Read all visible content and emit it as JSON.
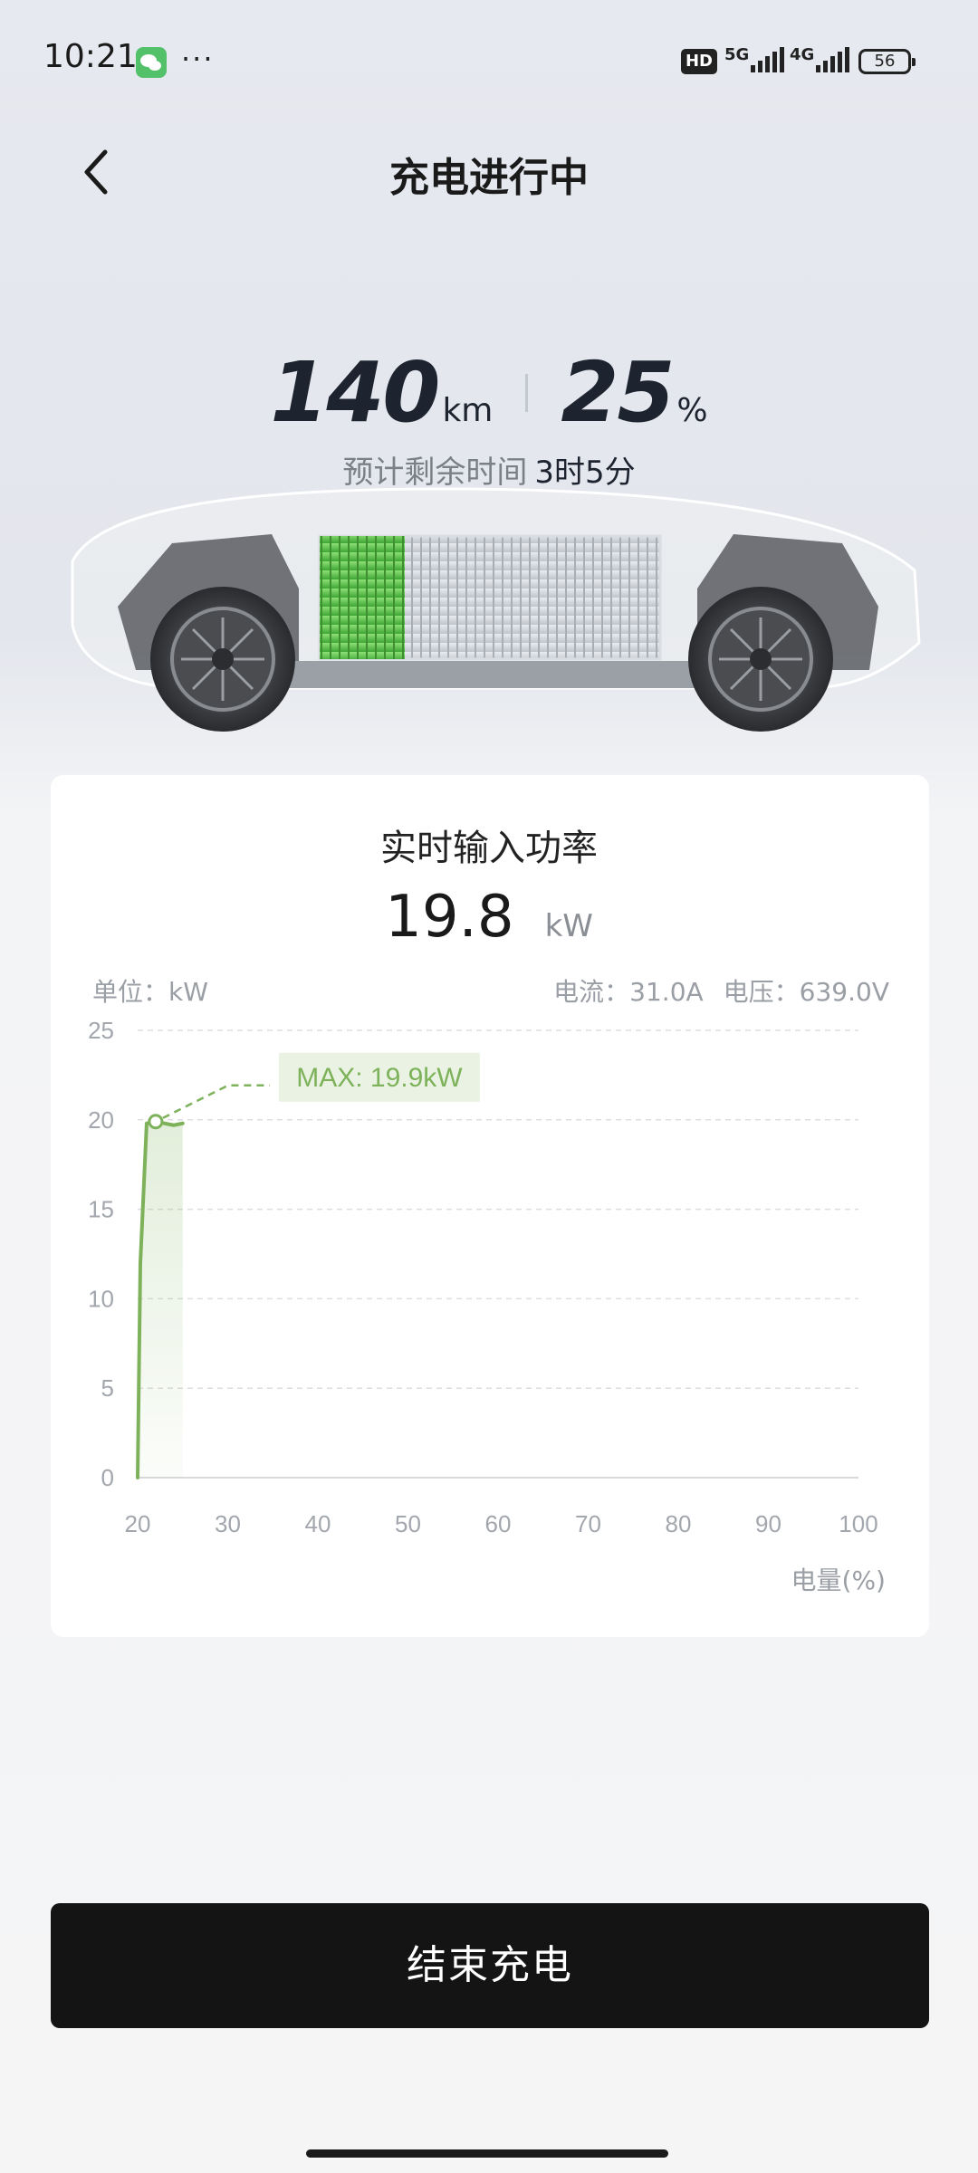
{
  "status_bar": {
    "time": "10:21",
    "dots": "···",
    "hd": "HD",
    "net1": "5G",
    "net2": "4G",
    "battery": "56",
    "icons": [
      "wechat-icon",
      "signal-5g-icon",
      "signal-4g-icon",
      "battery-icon"
    ]
  },
  "header": {
    "title": "充电进行中",
    "back_icon": "chevron-left-icon"
  },
  "stats": {
    "range_value": "140",
    "range_unit": "km",
    "soc_value": "25",
    "soc_unit": "%",
    "eta_label": "预计剩余时间",
    "eta_value": "3时5分"
  },
  "battery_fill": 0.25,
  "colors": {
    "accent_green": "#7db25b",
    "battery_green": "#5cc24a",
    "button_bg": "#141414"
  },
  "card": {
    "title": "实时输入功率",
    "power_value": "19.8",
    "power_unit": "kW",
    "unit_label": "单位：kW",
    "current": "电流：31.0A",
    "voltage": "电压：639.0V",
    "xlabel": "电量(%)"
  },
  "chart_data": {
    "type": "area",
    "x": [
      20,
      20.3,
      21,
      22,
      23,
      24,
      25
    ],
    "values": [
      0,
      12,
      19.8,
      19.9,
      19.8,
      19.7,
      19.8
    ],
    "xlim": [
      20,
      100
    ],
    "ylim": [
      0,
      25
    ],
    "xticks": [
      20,
      30,
      40,
      50,
      60,
      70,
      80,
      90,
      100
    ],
    "yticks": [
      0,
      5,
      10,
      15,
      20,
      25
    ],
    "grid": true,
    "annotation": "MAX: 19.9kW",
    "max_point": {
      "x": 22,
      "y": 19.9
    },
    "ylabel": "单位：kW",
    "xlabel": "电量(%)"
  },
  "actions": {
    "end_charging": "结束充电"
  }
}
